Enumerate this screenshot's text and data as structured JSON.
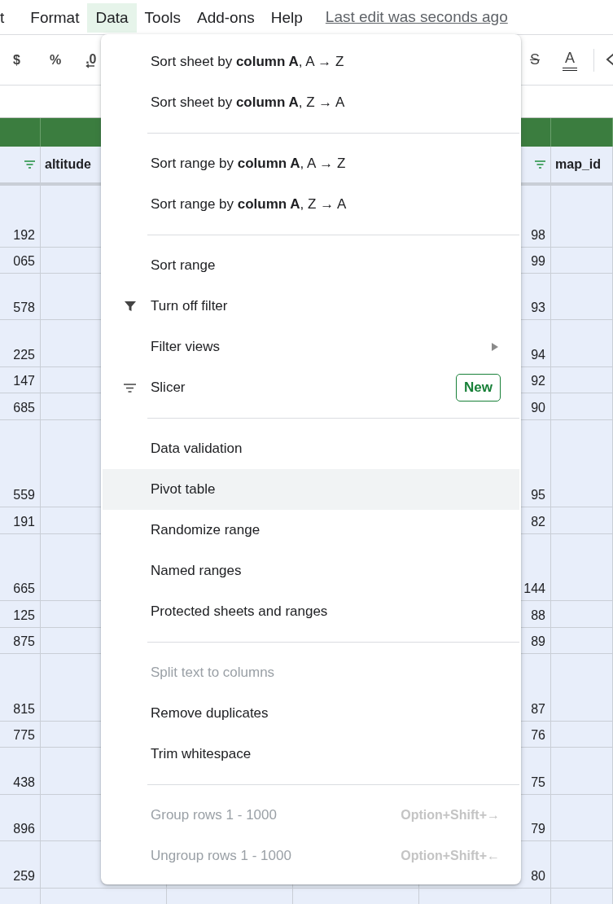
{
  "menubar": {
    "items": [
      {
        "label": "t",
        "selected": false
      },
      {
        "label": "Format",
        "selected": false
      },
      {
        "label": "Data",
        "selected": true
      },
      {
        "label": "Tools",
        "selected": false
      },
      {
        "label": "Add-ons",
        "selected": false
      },
      {
        "label": "Help",
        "selected": false
      }
    ],
    "status_link": "Last edit was seconds ago"
  },
  "toolbar": {
    "left": [
      {
        "kind": "plain",
        "label": "$"
      },
      {
        "kind": "plain",
        "label": "%"
      },
      {
        "kind": "decimal",
        "label": ".0"
      }
    ],
    "right": [
      {
        "kind": "strike",
        "label": "S"
      },
      {
        "kind": "color",
        "label": "A"
      }
    ]
  },
  "table": {
    "header": {
      "left_label": "altitude",
      "right_label": "map_id"
    },
    "rows": [
      {
        "cells": [
          "192",
          "98"
        ]
      },
      {
        "cells": [
          "065",
          "99"
        ]
      },
      {
        "cells": [
          "578",
          "93"
        ]
      },
      {
        "cells": [
          "225",
          "94"
        ]
      },
      {
        "cells": [
          "147",
          "92"
        ]
      },
      {
        "cells": [
          "685",
          "90"
        ]
      },
      {
        "cells": [
          "559",
          "95"
        ]
      },
      {
        "cells": [
          "191",
          "82"
        ]
      },
      {
        "cells": [
          "665",
          "144"
        ]
      },
      {
        "cells": [
          "125",
          "88"
        ]
      },
      {
        "cells": [
          "875",
          "89"
        ]
      },
      {
        "cells": [
          "815",
          "87"
        ]
      },
      {
        "cells": [
          "775",
          "76"
        ]
      },
      {
        "cells": [
          "438",
          "75"
        ]
      },
      {
        "cells": [
          "896",
          "79"
        ]
      },
      {
        "cells": [
          "259",
          "80"
        ]
      }
    ]
  },
  "menu": {
    "items": [
      {
        "kind": "plain",
        "label": "Sort sheet by **column A**, A → Z",
        "disabled": false,
        "highlighted": false
      },
      {
        "kind": "plain",
        "label": "Sort sheet by **column A**, Z → A",
        "disabled": false,
        "highlighted": false
      },
      {
        "kind": "separator"
      },
      {
        "kind": "plain",
        "label": "Sort range by **column A**, A → Z",
        "disabled": false,
        "highlighted": false
      },
      {
        "kind": "plain",
        "label": "Sort range by **column A**, Z → A",
        "disabled": false,
        "highlighted": false
      },
      {
        "kind": "separator"
      },
      {
        "kind": "plain",
        "label": "Sort range",
        "disabled": false,
        "highlighted": false
      },
      {
        "kind": "funnel",
        "label": "Turn off filter",
        "disabled": false,
        "highlighted": false
      },
      {
        "kind": "submenu",
        "label": "Filter views",
        "disabled": false,
        "highlighted": false
      },
      {
        "kind": "lines",
        "label": "Slicer",
        "badge": "New",
        "disabled": false,
        "highlighted": false
      },
      {
        "kind": "separator"
      },
      {
        "kind": "plain",
        "label": "Data validation",
        "disabled": false,
        "highlighted": false
      },
      {
        "kind": "plain",
        "label": "Pivot table",
        "disabled": false,
        "highlighted": true
      },
      {
        "kind": "plain",
        "label": "Randomize range",
        "disabled": false,
        "highlighted": false
      },
      {
        "kind": "plain",
        "label": "Named ranges",
        "disabled": false,
        "highlighted": false
      },
      {
        "kind": "plain",
        "label": "Protected sheets and ranges",
        "disabled": false,
        "highlighted": false
      },
      {
        "kind": "separator"
      },
      {
        "kind": "plain",
        "label": "Split text to columns",
        "disabled": true,
        "highlighted": false
      },
      {
        "kind": "plain",
        "label": "Remove duplicates",
        "disabled": false,
        "highlighted": false
      },
      {
        "kind": "plain",
        "label": "Trim whitespace",
        "disabled": false,
        "highlighted": false
      },
      {
        "kind": "separator"
      },
      {
        "kind": "plain",
        "label": "Group rows 1 - 1000",
        "shortcut": "Option+Shift+→",
        "disabled": true,
        "highlighted": false
      },
      {
        "kind": "plain",
        "label": "Ungroup rows 1 - 1000",
        "shortcut": "Option+Shift+←",
        "disabled": true,
        "highlighted": false
      }
    ]
  }
}
